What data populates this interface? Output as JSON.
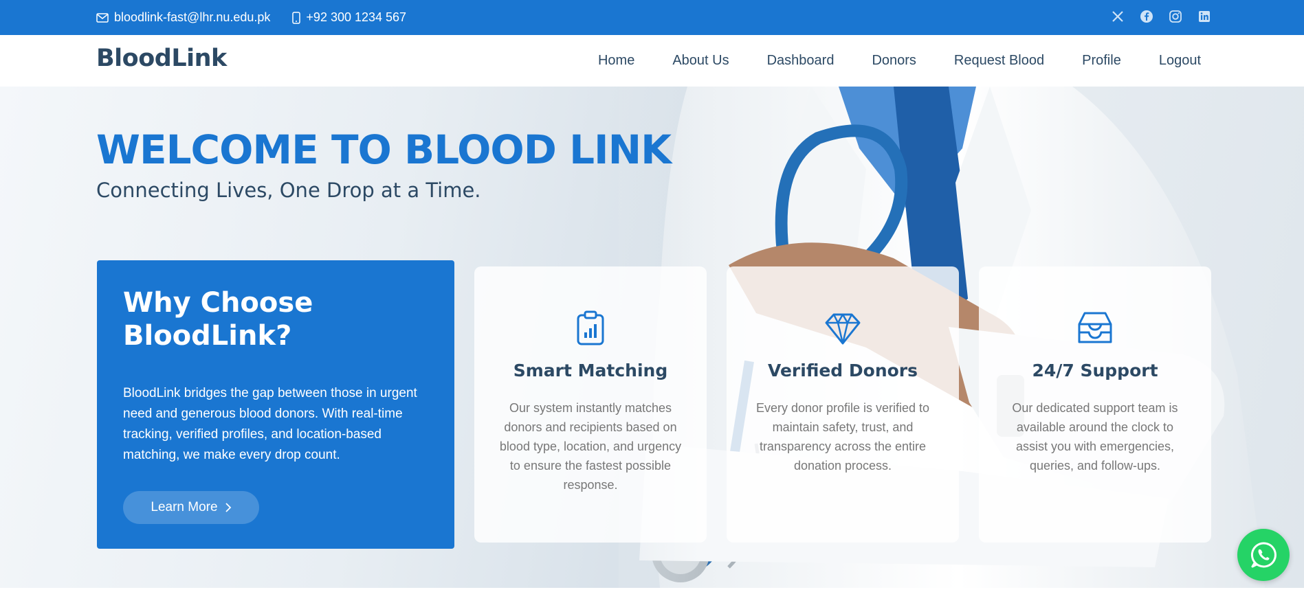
{
  "topbar": {
    "email": "bloodlink-fast@lhr.nu.edu.pk",
    "phone": "+92 300 1234 567",
    "social_icons": [
      "x-icon",
      "facebook-icon",
      "instagram-icon",
      "linkedin-icon"
    ]
  },
  "navbar": {
    "brand": "BloodLink",
    "links": [
      "Home",
      "About Us",
      "Dashboard",
      "Donors",
      "Request Blood",
      "Profile",
      "Logout"
    ]
  },
  "hero": {
    "title": "WELCOME TO BLOOD LINK",
    "subtitle": "Connecting Lives, One Drop at a Time."
  },
  "why": {
    "heading": "Why Choose BloodLink?",
    "body": "BloodLink bridges the gap between those in urgent need and generous blood donors. With real-time tracking, verified profiles, and location-based matching, we make every drop count.",
    "button": "Learn More"
  },
  "cards": [
    {
      "icon": "clipboard-data-icon",
      "title": "Smart Matching",
      "text": "Our system instantly matches donors and recipients based on blood type, location, and urgency to ensure the fastest possible response."
    },
    {
      "icon": "gem-icon",
      "title": "Verified Donors",
      "text": "Every donor profile is verified to maintain safety, trust, and transparency across the entire donation process."
    },
    {
      "icon": "inbox-icon",
      "title": "24/7 Support",
      "text": "Our dedicated support team is available around the clock to assist you with emergencies, queries, and follow-ups."
    }
  ],
  "colors": {
    "primary": "#1a76d1",
    "heading": "#2c4964",
    "whatsapp": "#25d366"
  }
}
